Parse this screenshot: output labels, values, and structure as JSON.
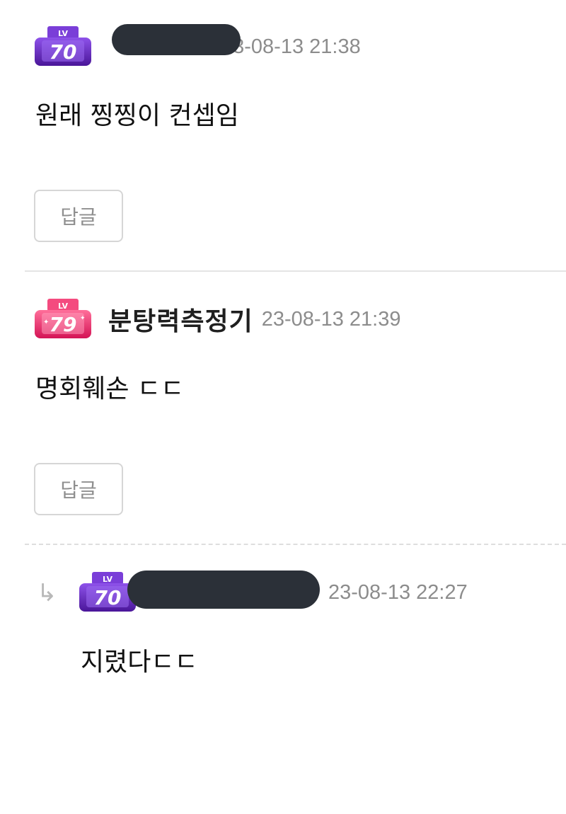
{
  "comments": [
    {
      "level": "70",
      "badge_color": "#6b2fc7",
      "nickname": "",
      "timestamp": "23-08-13 21:38",
      "text": "원래 찡찡이 컨셉임",
      "reply_label": "답글"
    },
    {
      "level": "79",
      "badge_color": "#f0336e",
      "nickname": "분탕력측정기",
      "timestamp": "23-08-13 21:39",
      "text": "명회훼손 ㄷㄷ",
      "reply_label": "답글"
    }
  ],
  "reply": {
    "arrow_icon": "reply-arrow-icon",
    "level": "70",
    "badge_color": "#6b2fc7",
    "nickname": "",
    "timestamp": "23-08-13 22:27",
    "text": "지렸다ㄷㄷ"
  },
  "colors": {
    "redaction": "#2b3038",
    "timestamp": "#8c8c8c",
    "divider": "#e4e4e4"
  }
}
